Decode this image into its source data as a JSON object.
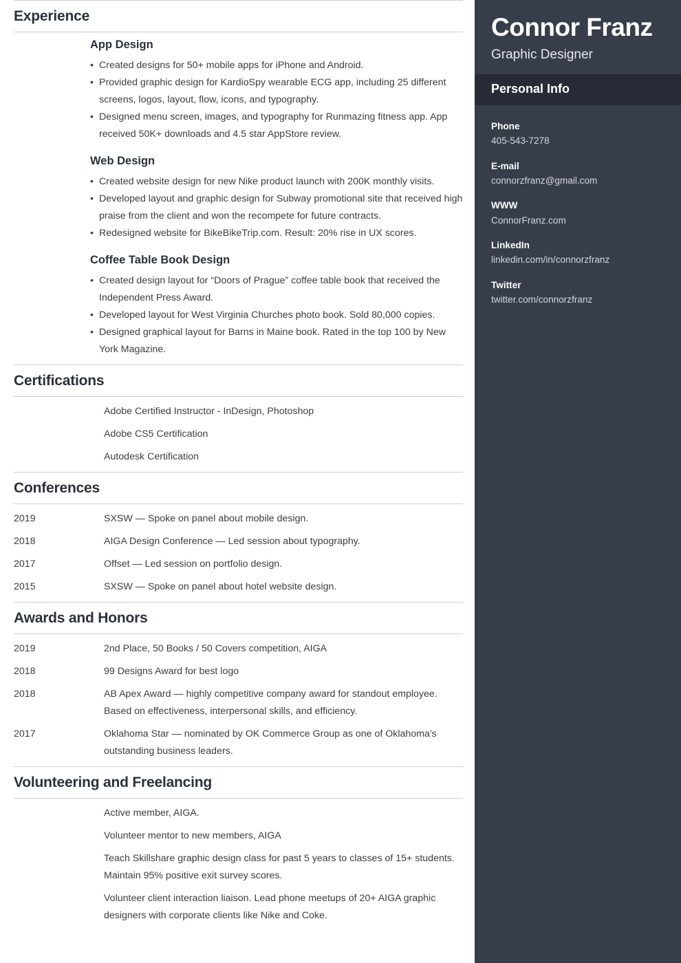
{
  "colors": {
    "sidebar_bg": "#373d49",
    "sidebar_band_bg": "#272b35",
    "heading": "#2b303b",
    "body_text": "#3d3d3d",
    "rule": "#cfcfcf"
  },
  "sidebar": {
    "name": "Connor Franz",
    "role": "Graphic Designer",
    "personal_info_title": "Personal Info",
    "contacts": [
      {
        "label": "Phone",
        "value": "405-543-7278"
      },
      {
        "label": "E-mail",
        "value": "connorzfranz@gmail.com"
      },
      {
        "label": "WWW",
        "value": "ConnorFranz.com"
      },
      {
        "label": "LinkedIn",
        "value": "linkedin.com/in/connorzfranz"
      },
      {
        "label": "Twitter",
        "value": "twitter.com/connorzfranz"
      }
    ]
  },
  "sections": {
    "experience": {
      "title": "Experience",
      "jobs": [
        {
          "title": "App Design",
          "bullets": [
            "Created designs for 50+ mobile apps for iPhone and Android.",
            "Provided graphic design for KardioSpy wearable ECG app, including 25 different screens, logos, layout, flow, icons, and typography.",
            "Designed menu screen, images, and typography for Runmazing fitness app. App received 50K+ downloads and 4.5 star AppStore review."
          ]
        },
        {
          "title": "Web Design",
          "bullets": [
            "Created website design for new Nike product launch with 200K monthly visits.",
            "Developed layout and graphic design for Subway promotional site that received high praise from the client and won the recompete for future contracts.",
            "Redesigned website for BikeBikeTrip.com. Result: 20% rise in UX scores."
          ]
        },
        {
          "title": "Coffee Table Book Design",
          "bullets": [
            "Created design layout for “Doors of Prague” coffee table book that received the Independent Press Award.",
            "Developed layout for West Virginia Churches photo book. Sold 80,000 copies.",
            "Designed graphical layout for Barns in Maine book. Rated in the top 100 by New York Magazine."
          ]
        }
      ]
    },
    "certifications": {
      "title": "Certifications",
      "items": [
        "Adobe Certified Instructor - InDesign, Photoshop",
        "Adobe CS5 Certification",
        "Autodesk Certification"
      ]
    },
    "conferences": {
      "title": "Conferences",
      "entries": [
        {
          "year": "2019",
          "text": "SXSW — Spoke on panel about mobile design."
        },
        {
          "year": "2018",
          "text": "AIGA Design Conference — Led session about typography."
        },
        {
          "year": "2017",
          "text": "Offset — Led session on portfolio design."
        },
        {
          "year": "2015",
          "text": "SXSW — Spoke on panel about hotel website design."
        }
      ]
    },
    "awards": {
      "title": "Awards and Honors",
      "entries": [
        {
          "year": "2019",
          "text": "2nd Place, 50 Books / 50 Covers competition, AIGA"
        },
        {
          "year": "2018",
          "text": "99 Designs Award for best logo"
        },
        {
          "year": "2018",
          "text": "AB Apex Award — highly competitive company award for standout employee. Based on effectiveness, interpersonal skills, and efficiency."
        },
        {
          "year": "2017",
          "text": "Oklahoma Star — nominated by OK Commerce Group as one of Oklahoma's outstanding business leaders."
        }
      ]
    },
    "volunteering": {
      "title": "Volunteering and Freelancing",
      "items": [
        "Active member, AIGA.",
        "Volunteer mentor to new members, AIGA",
        "Teach Skillshare graphic design class for past 5 years to classes of 15+ students. Maintain 95% positive exit survey scores.",
        "Volunteer client interaction liaison. Lead phone meetups of 20+ AIGA graphic designers with corporate clients like Nike and Coke."
      ]
    }
  }
}
